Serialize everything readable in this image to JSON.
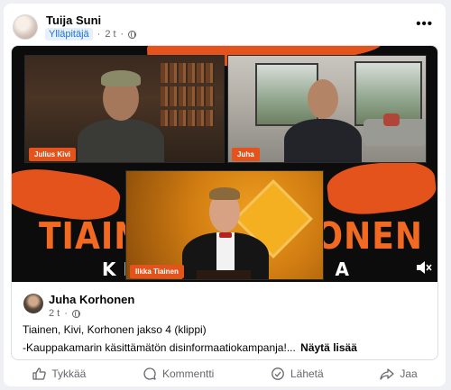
{
  "post": {
    "author": "Tuija Suni",
    "role_badge": "Ylläpitäjä",
    "time": "2 t",
    "separator": "·",
    "more_label": "•••"
  },
  "video": {
    "participants": [
      {
        "nameplate": "Julius Kivi"
      },
      {
        "nameplate": "Juha"
      },
      {
        "nameplate": "Ilkka Tiainen"
      }
    ],
    "title_left": "TIAIN",
    "title_right": "HONEN",
    "subtitle_left": "KES",
    "subtitle_right": "A"
  },
  "shared": {
    "author": "Juha Korhonen",
    "time": "2 t",
    "separator": "·",
    "text_line1": "Tiainen, Kivi, Korhonen jakso 4 (klippi)",
    "text_line2": "-Kauppakamarin käsittämätön disinformaatiokampanja!...",
    "see_more": "Näytä lisää"
  },
  "actions": [
    {
      "label": "Tykkää",
      "icon": "like-icon"
    },
    {
      "label": "Kommentti",
      "icon": "comment-icon"
    },
    {
      "label": "Lähetä",
      "icon": "send-icon"
    },
    {
      "label": "Jaa",
      "icon": "share-icon"
    }
  ],
  "colors": {
    "accent_orange": "#f26a21",
    "badge_blue": "#1b74e4",
    "muted_text": "#65676b"
  }
}
